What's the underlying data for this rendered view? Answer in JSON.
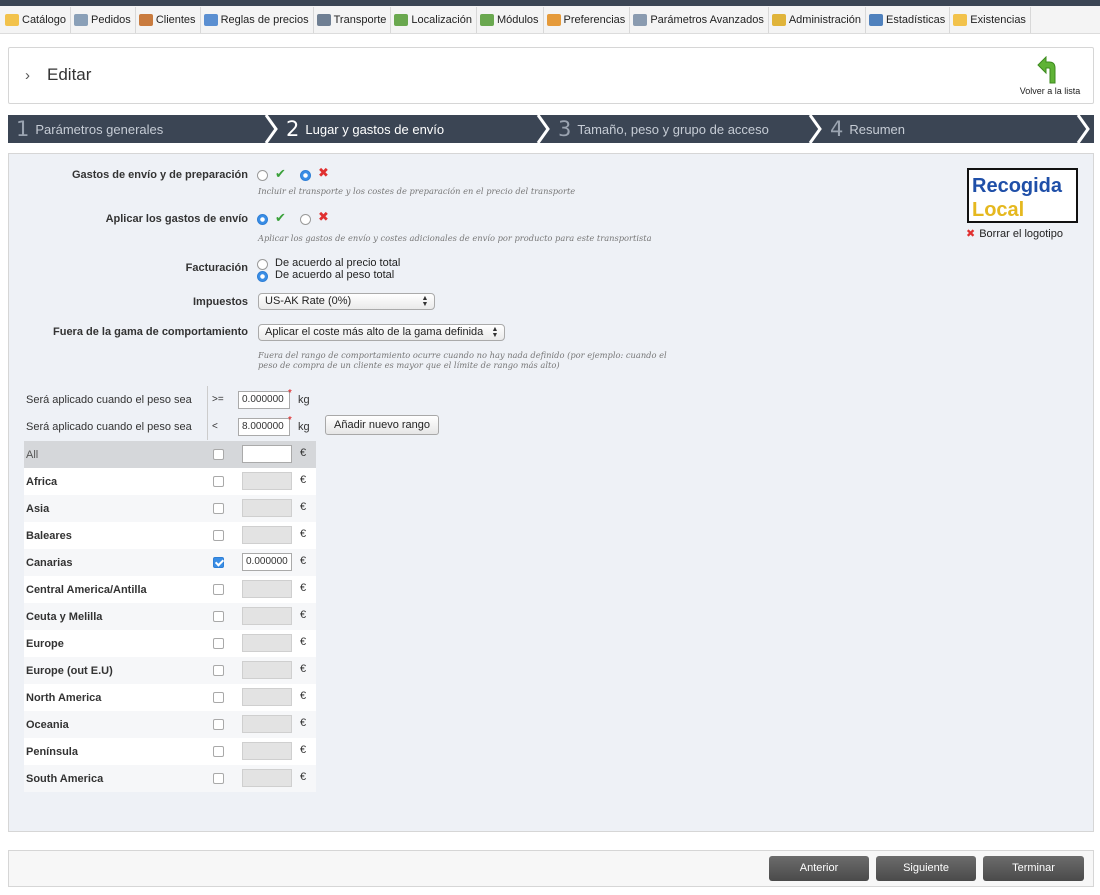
{
  "menu": [
    {
      "label": "Catálogo",
      "icon": "folder-icon",
      "color": "#f2c24b"
    },
    {
      "label": "Pedidos",
      "icon": "cart-icon",
      "color": "#8aa0b8"
    },
    {
      "label": "Clientes",
      "icon": "users-icon",
      "color": "#c97b3e"
    },
    {
      "label": "Reglas de precios",
      "icon": "price-rules-icon",
      "color": "#5b8fd1"
    },
    {
      "label": "Transporte",
      "icon": "truck-icon",
      "color": "#6f7f93"
    },
    {
      "label": "Localización",
      "icon": "globe-icon",
      "color": "#6aa84f"
    },
    {
      "label": "Módulos",
      "icon": "puzzle-icon",
      "color": "#6aa84f"
    },
    {
      "label": "Preferencias",
      "icon": "preferences-icon",
      "color": "#e59a3a"
    },
    {
      "label": "Parámetros Avanzados",
      "icon": "wrench-icon",
      "color": "#8a9bb0"
    },
    {
      "label": "Administración",
      "icon": "key-icon",
      "color": "#e0b43a"
    },
    {
      "label": "Estadísticas",
      "icon": "bar-chart-icon",
      "color": "#4f81bd"
    },
    {
      "label": "Existencias",
      "icon": "stock-icon",
      "color": "#f2c24b"
    }
  ],
  "header": {
    "title": "Editar",
    "back_label": "Volver a la lista"
  },
  "steps": [
    {
      "num": "1",
      "label": "Parámetros generales"
    },
    {
      "num": "2",
      "label": "Lugar y gastos de envío"
    },
    {
      "num": "3",
      "label": "Tamaño, peso y grupo de acceso"
    },
    {
      "num": "4",
      "label": "Resumen"
    }
  ],
  "form": {
    "shipping_handling": {
      "label": "Gastos de envío y de preparación",
      "value": "no",
      "hint": "Incluir el transporte y los costes de preparación en el precio del transporte"
    },
    "apply_shipping": {
      "label": "Aplicar los gastos de envío",
      "value": "yes",
      "hint": "Aplicar los gastos de envío y costes adicionales de envío por producto para este transportista"
    },
    "billing": {
      "label": "Facturación",
      "options": [
        "De acuerdo al precio total",
        "De acuerdo al peso total"
      ],
      "selected": 1
    },
    "tax": {
      "label": "Impuestos",
      "selected": "US-AK Rate (0%)"
    },
    "out_of_range": {
      "label": "Fuera de la gama de comportamiento",
      "selected": "Aplicar el coste más alto de la gama definida",
      "hint_line1": "Fuera del rango de comportamiento ocurre cuando no hay nada definido (por ejemplo: cuando el",
      "hint_line2": "peso de compra de un cliente es mayor que el límite de rango más alto)"
    }
  },
  "logo": {
    "line1": "Recogida",
    "line2": "Local",
    "delete_label": "Borrar el logotipo"
  },
  "ranges": [
    {
      "label": "Será aplicado cuando el peso sea",
      "op": ">=",
      "value": "0.000000",
      "unit": "kg"
    },
    {
      "label": "Será aplicado cuando el peso sea",
      "op": "<",
      "value": "8.000000",
      "unit": "kg"
    }
  ],
  "add_range_label": "Añadir nuevo rango",
  "currency": "€",
  "zones": [
    {
      "name": "All",
      "checked": false,
      "value": ""
    },
    {
      "name": "Africa",
      "checked": false,
      "value": ""
    },
    {
      "name": "Asia",
      "checked": false,
      "value": ""
    },
    {
      "name": "Baleares",
      "checked": false,
      "value": ""
    },
    {
      "name": "Canarias",
      "checked": true,
      "value": "0.000000"
    },
    {
      "name": "Central America/Antilla",
      "checked": false,
      "value": ""
    },
    {
      "name": "Ceuta y Melilla",
      "checked": false,
      "value": ""
    },
    {
      "name": "Europe",
      "checked": false,
      "value": ""
    },
    {
      "name": "Europe (out E.U)",
      "checked": false,
      "value": ""
    },
    {
      "name": "North America",
      "checked": false,
      "value": ""
    },
    {
      "name": "Oceania",
      "checked": false,
      "value": ""
    },
    {
      "name": "Península",
      "checked": false,
      "value": ""
    },
    {
      "name": "South America",
      "checked": false,
      "value": ""
    }
  ],
  "footer": {
    "prev": "Anterior",
    "next": "Siguiente",
    "finish": "Terminar"
  }
}
